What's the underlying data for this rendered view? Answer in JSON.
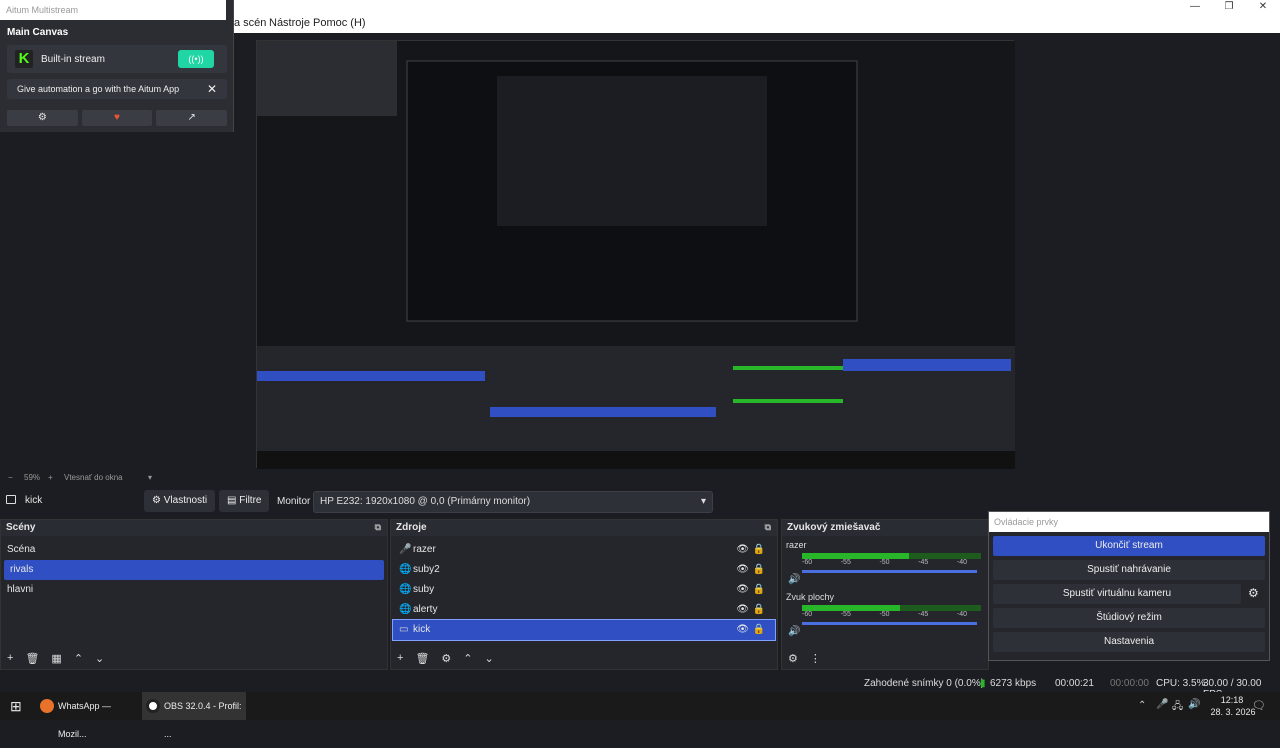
{
  "menubar": {
    "items": [
      "a scén",
      "Nástroje",
      "Pomoc (H)"
    ]
  },
  "aitum": {
    "title": "Aitum Multistream",
    "section": "Main Canvas",
    "stream_label": "Built-in stream",
    "stream_toggle": "((•))",
    "promo": "Give automation a go with the Aitum App",
    "promo_close": "✕",
    "buttons": [
      "⚙",
      "♥",
      "↗"
    ]
  },
  "zoom": {
    "value": "59%",
    "fit": "Vtesnať do okna"
  },
  "toolbar": {
    "source_name": "kick",
    "properties": "Vlastnosti",
    "filters": "Filtre",
    "monitor_label": "Monitor",
    "monitor_value": "HP E232: 1920x1080 @ 0,0 (Primárny monitor)"
  },
  "scenes": {
    "title": "Scény",
    "items": [
      {
        "label": "Scéna"
      },
      {
        "label": "rivals"
      },
      {
        "label": "hlavni"
      }
    ]
  },
  "sources": {
    "title": "Zdroje",
    "items": [
      {
        "label": "razer",
        "icon": "mic-icon"
      },
      {
        "label": "suby2",
        "icon": "globe-icon"
      },
      {
        "label": "suby",
        "icon": "globe-icon"
      },
      {
        "label": "alerty",
        "icon": "globe-icon"
      },
      {
        "label": "kick",
        "icon": "monitor-icon"
      }
    ]
  },
  "mixer": {
    "title": "Zvukový zmiešavač",
    "tracks": [
      {
        "name": "razer",
        "level": 0.6
      },
      {
        "name": "Zvuk plochy",
        "level": 0.55
      }
    ],
    "scale": [
      "-60",
      "-55",
      "-50",
      "-45",
      "-40"
    ]
  },
  "controls": {
    "title": "Ovládacie prvky",
    "buttons": [
      "Ukončiť stream",
      "Spustiť nahrávanie",
      "Spustiť virtuálnu kameru",
      "Štúdiový režim",
      "Nastavenia"
    ]
  },
  "status": {
    "dropped": "Zahodené snímky 0 (0.0%)",
    "bitrate": "6273 kbps",
    "stream_time": "00:00:21",
    "rec_time": "00:00:00",
    "cpu": "CPU: 3.5%",
    "fps": "30.00 / 30.00 FPS"
  },
  "taskbar": {
    "apps": [
      "WhatsApp — Mozil...",
      "OBS 32.0.4 - Profil: ..."
    ],
    "time": "12:18",
    "date": "28. 3. 2026"
  },
  "colors": {
    "accent": "#2f4fc2",
    "meter": "#28b728",
    "kick": "#53fc18",
    "toggle": "#1fd6a4"
  }
}
